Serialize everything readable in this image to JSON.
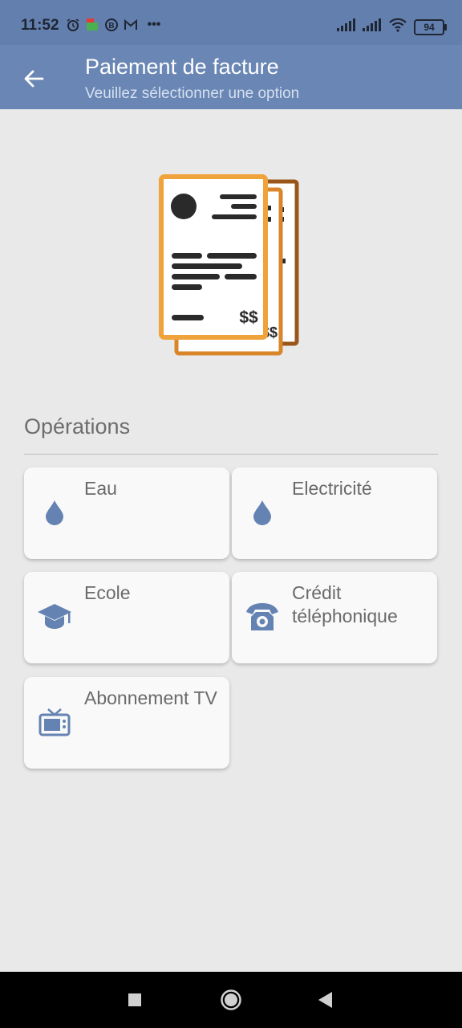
{
  "status_bar": {
    "time": "11:52",
    "battery": "94",
    "more": "•••"
  },
  "appbar": {
    "title": "Paiement de facture",
    "subtitle": "Veuillez sélectionner une option"
  },
  "illustration": {
    "amount_symbol": "$$"
  },
  "section": {
    "title": "Opérations"
  },
  "operations": [
    {
      "label": "Eau",
      "icon": "water-drop-icon"
    },
    {
      "label": "Electricité",
      "icon": "water-drop-icon"
    },
    {
      "label": "Ecole",
      "icon": "graduation-cap-icon"
    },
    {
      "label": "Crédit téléphonique",
      "icon": "telephone-icon"
    },
    {
      "label": "Abonnement TV",
      "icon": "tv-icon"
    }
  ],
  "colors": {
    "primary": "#6986b4",
    "status_bar": "#637fae",
    "icon_accent": "#6583b2",
    "invoice_front": "#f0a23b",
    "invoice_back": "#9a561a"
  }
}
